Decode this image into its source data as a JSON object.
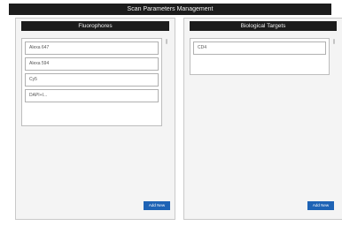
{
  "window": {
    "title": "Scan Parameters Management"
  },
  "fluorophores": {
    "header": "Fluorophores",
    "items": [
      {
        "label": "Alexa 647"
      },
      {
        "label": "Alexa 594"
      },
      {
        "label": "Cy5"
      },
      {
        "label": "DAPI+I..."
      }
    ],
    "add_label": "Add New"
  },
  "biological_targets": {
    "header": "Biological Targets",
    "items": [
      {
        "label": "CD4"
      }
    ],
    "add_label": "Add New"
  },
  "colors": {
    "title_bar": "#1c1c1c",
    "panel_bg": "#f4f4f4",
    "accent": "#1e63b5"
  }
}
